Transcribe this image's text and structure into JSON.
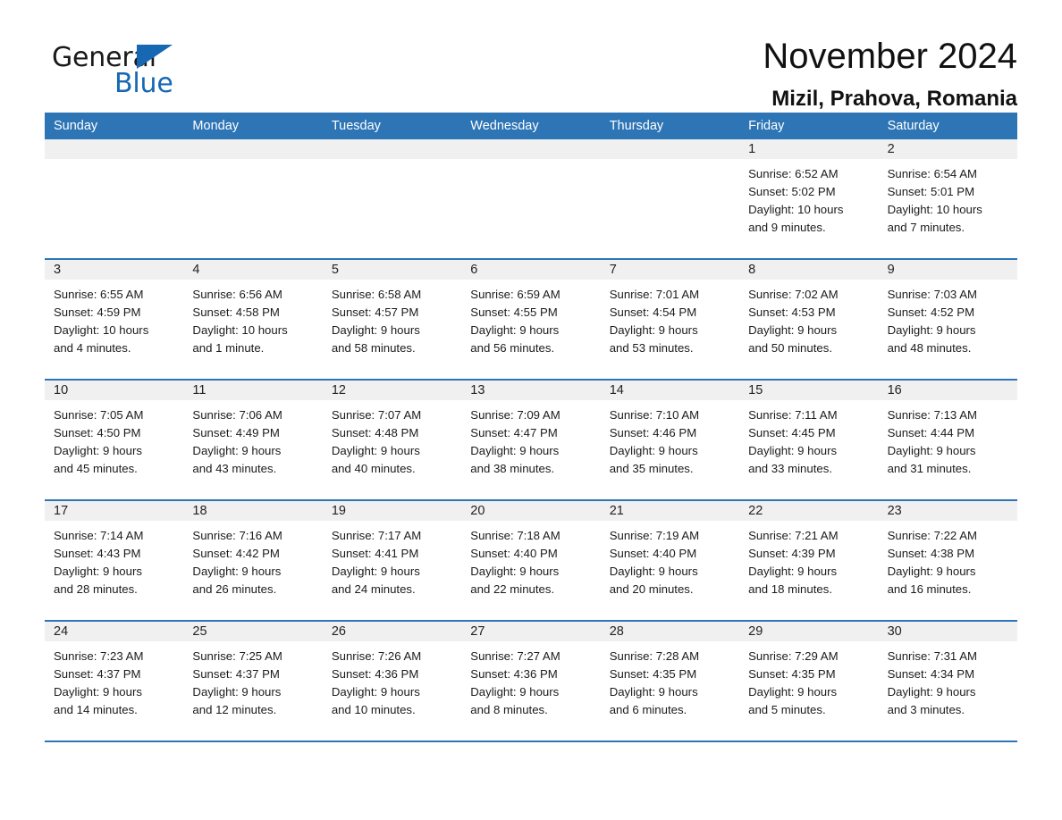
{
  "brand": {
    "name_part1": "General",
    "name_part2": "Blue",
    "logo_icon": "triangle-logo-icon",
    "accent_color": "#1668b3"
  },
  "header": {
    "title": "November 2024",
    "subtitle": "Mizil, Prahova, Romania",
    "header_bg_color": "#2e75b6",
    "day_band_color": "#f0f0f0"
  },
  "weekdays": [
    "Sunday",
    "Monday",
    "Tuesday",
    "Wednesday",
    "Thursday",
    "Friday",
    "Saturday"
  ],
  "weeks": [
    [
      {
        "day": "",
        "empty": true,
        "sunrise": "",
        "sunset": "",
        "daylight1": "",
        "daylight2": ""
      },
      {
        "day": "",
        "empty": true,
        "sunrise": "",
        "sunset": "",
        "daylight1": "",
        "daylight2": ""
      },
      {
        "day": "",
        "empty": true,
        "sunrise": "",
        "sunset": "",
        "daylight1": "",
        "daylight2": ""
      },
      {
        "day": "",
        "empty": true,
        "sunrise": "",
        "sunset": "",
        "daylight1": "",
        "daylight2": ""
      },
      {
        "day": "",
        "empty": true,
        "sunrise": "",
        "sunset": "",
        "daylight1": "",
        "daylight2": ""
      },
      {
        "day": "1",
        "sunrise": "Sunrise: 6:52 AM",
        "sunset": "Sunset: 5:02 PM",
        "daylight1": "Daylight: 10 hours",
        "daylight2": "and 9 minutes."
      },
      {
        "day": "2",
        "sunrise": "Sunrise: 6:54 AM",
        "sunset": "Sunset: 5:01 PM",
        "daylight1": "Daylight: 10 hours",
        "daylight2": "and 7 minutes."
      }
    ],
    [
      {
        "day": "3",
        "sunrise": "Sunrise: 6:55 AM",
        "sunset": "Sunset: 4:59 PM",
        "daylight1": "Daylight: 10 hours",
        "daylight2": "and 4 minutes."
      },
      {
        "day": "4",
        "sunrise": "Sunrise: 6:56 AM",
        "sunset": "Sunset: 4:58 PM",
        "daylight1": "Daylight: 10 hours",
        "daylight2": "and 1 minute."
      },
      {
        "day": "5",
        "sunrise": "Sunrise: 6:58 AM",
        "sunset": "Sunset: 4:57 PM",
        "daylight1": "Daylight: 9 hours",
        "daylight2": "and 58 minutes."
      },
      {
        "day": "6",
        "sunrise": "Sunrise: 6:59 AM",
        "sunset": "Sunset: 4:55 PM",
        "daylight1": "Daylight: 9 hours",
        "daylight2": "and 56 minutes."
      },
      {
        "day": "7",
        "sunrise": "Sunrise: 7:01 AM",
        "sunset": "Sunset: 4:54 PM",
        "daylight1": "Daylight: 9 hours",
        "daylight2": "and 53 minutes."
      },
      {
        "day": "8",
        "sunrise": "Sunrise: 7:02 AM",
        "sunset": "Sunset: 4:53 PM",
        "daylight1": "Daylight: 9 hours",
        "daylight2": "and 50 minutes."
      },
      {
        "day": "9",
        "sunrise": "Sunrise: 7:03 AM",
        "sunset": "Sunset: 4:52 PM",
        "daylight1": "Daylight: 9 hours",
        "daylight2": "and 48 minutes."
      }
    ],
    [
      {
        "day": "10",
        "sunrise": "Sunrise: 7:05 AM",
        "sunset": "Sunset: 4:50 PM",
        "daylight1": "Daylight: 9 hours",
        "daylight2": "and 45 minutes."
      },
      {
        "day": "11",
        "sunrise": "Sunrise: 7:06 AM",
        "sunset": "Sunset: 4:49 PM",
        "daylight1": "Daylight: 9 hours",
        "daylight2": "and 43 minutes."
      },
      {
        "day": "12",
        "sunrise": "Sunrise: 7:07 AM",
        "sunset": "Sunset: 4:48 PM",
        "daylight1": "Daylight: 9 hours",
        "daylight2": "and 40 minutes."
      },
      {
        "day": "13",
        "sunrise": "Sunrise: 7:09 AM",
        "sunset": "Sunset: 4:47 PM",
        "daylight1": "Daylight: 9 hours",
        "daylight2": "and 38 minutes."
      },
      {
        "day": "14",
        "sunrise": "Sunrise: 7:10 AM",
        "sunset": "Sunset: 4:46 PM",
        "daylight1": "Daylight: 9 hours",
        "daylight2": "and 35 minutes."
      },
      {
        "day": "15",
        "sunrise": "Sunrise: 7:11 AM",
        "sunset": "Sunset: 4:45 PM",
        "daylight1": "Daylight: 9 hours",
        "daylight2": "and 33 minutes."
      },
      {
        "day": "16",
        "sunrise": "Sunrise: 7:13 AM",
        "sunset": "Sunset: 4:44 PM",
        "daylight1": "Daylight: 9 hours",
        "daylight2": "and 31 minutes."
      }
    ],
    [
      {
        "day": "17",
        "sunrise": "Sunrise: 7:14 AM",
        "sunset": "Sunset: 4:43 PM",
        "daylight1": "Daylight: 9 hours",
        "daylight2": "and 28 minutes."
      },
      {
        "day": "18",
        "sunrise": "Sunrise: 7:16 AM",
        "sunset": "Sunset: 4:42 PM",
        "daylight1": "Daylight: 9 hours",
        "daylight2": "and 26 minutes."
      },
      {
        "day": "19",
        "sunrise": "Sunrise: 7:17 AM",
        "sunset": "Sunset: 4:41 PM",
        "daylight1": "Daylight: 9 hours",
        "daylight2": "and 24 minutes."
      },
      {
        "day": "20",
        "sunrise": "Sunrise: 7:18 AM",
        "sunset": "Sunset: 4:40 PM",
        "daylight1": "Daylight: 9 hours",
        "daylight2": "and 22 minutes."
      },
      {
        "day": "21",
        "sunrise": "Sunrise: 7:19 AM",
        "sunset": "Sunset: 4:40 PM",
        "daylight1": "Daylight: 9 hours",
        "daylight2": "and 20 minutes."
      },
      {
        "day": "22",
        "sunrise": "Sunrise: 7:21 AM",
        "sunset": "Sunset: 4:39 PM",
        "daylight1": "Daylight: 9 hours",
        "daylight2": "and 18 minutes."
      },
      {
        "day": "23",
        "sunrise": "Sunrise: 7:22 AM",
        "sunset": "Sunset: 4:38 PM",
        "daylight1": "Daylight: 9 hours",
        "daylight2": "and 16 minutes."
      }
    ],
    [
      {
        "day": "24",
        "sunrise": "Sunrise: 7:23 AM",
        "sunset": "Sunset: 4:37 PM",
        "daylight1": "Daylight: 9 hours",
        "daylight2": "and 14 minutes."
      },
      {
        "day": "25",
        "sunrise": "Sunrise: 7:25 AM",
        "sunset": "Sunset: 4:37 PM",
        "daylight1": "Daylight: 9 hours",
        "daylight2": "and 12 minutes."
      },
      {
        "day": "26",
        "sunrise": "Sunrise: 7:26 AM",
        "sunset": "Sunset: 4:36 PM",
        "daylight1": "Daylight: 9 hours",
        "daylight2": "and 10 minutes."
      },
      {
        "day": "27",
        "sunrise": "Sunrise: 7:27 AM",
        "sunset": "Sunset: 4:36 PM",
        "daylight1": "Daylight: 9 hours",
        "daylight2": "and 8 minutes."
      },
      {
        "day": "28",
        "sunrise": "Sunrise: 7:28 AM",
        "sunset": "Sunset: 4:35 PM",
        "daylight1": "Daylight: 9 hours",
        "daylight2": "and 6 minutes."
      },
      {
        "day": "29",
        "sunrise": "Sunrise: 7:29 AM",
        "sunset": "Sunset: 4:35 PM",
        "daylight1": "Daylight: 9 hours",
        "daylight2": "and 5 minutes."
      },
      {
        "day": "30",
        "sunrise": "Sunrise: 7:31 AM",
        "sunset": "Sunset: 4:34 PM",
        "daylight1": "Daylight: 9 hours",
        "daylight2": "and 3 minutes."
      }
    ]
  ]
}
